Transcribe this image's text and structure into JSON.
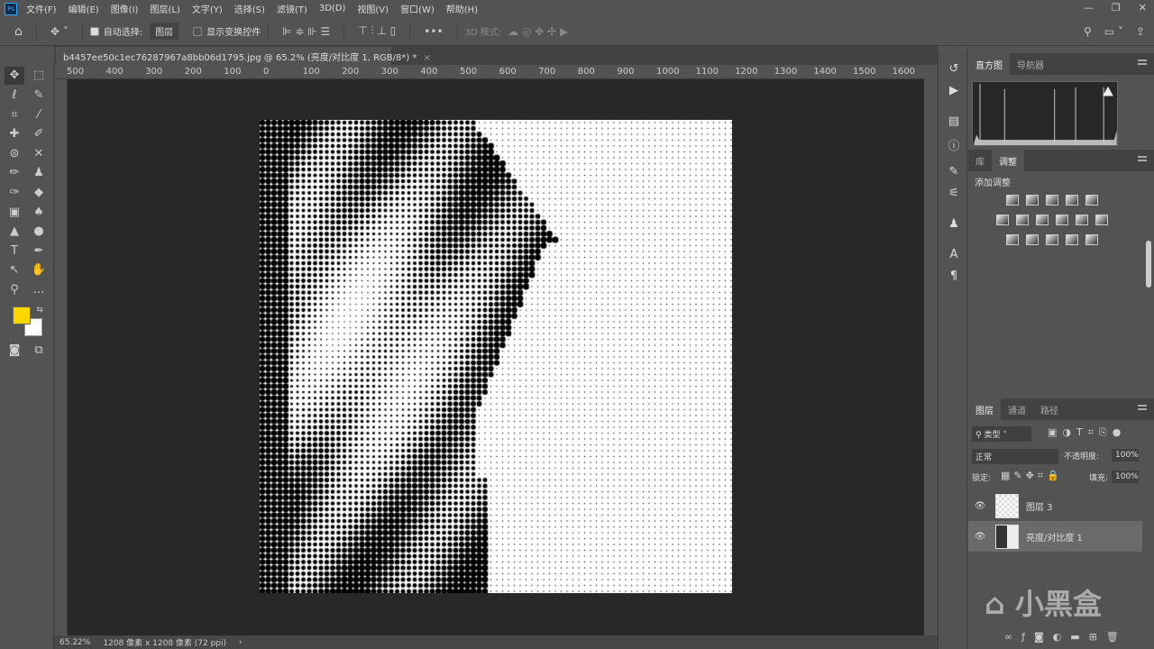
{
  "app": {
    "logo": "Ps"
  },
  "menu": [
    "文件(F)",
    "编辑(E)",
    "图像(I)",
    "图层(L)",
    "文字(Y)",
    "选择(S)",
    "滤镜(T)",
    "3D(D)",
    "视图(V)",
    "窗口(W)",
    "帮助(H)"
  ],
  "window_buttons": [
    "—",
    "❐",
    "✕"
  ],
  "options": {
    "auto_select_label": "自动选择:",
    "auto_select_value": "图层",
    "show_transform_label": "显示变换控件",
    "mode_3d_label": "3D 模式:",
    "more": "•••"
  },
  "document": {
    "tab_title": "b4457ee50c1ec76287967a8bb06d1795.jpg @ 65.2% (亮度/对比度 1, RGB/8*) *",
    "close": "×"
  },
  "ruler_top": [
    "500",
    "400",
    "300",
    "200",
    "100",
    "0",
    "100",
    "200",
    "300",
    "400",
    "500",
    "600",
    "700",
    "800",
    "900",
    "1000",
    "1100",
    "1200",
    "1300",
    "1400",
    "1500",
    "1600"
  ],
  "status": {
    "zoom": "65.22%",
    "info": "1208 像素 x 1208 像素 (72 ppi)",
    "arrow": "›"
  },
  "colors": {
    "foreground": "#ffd800",
    "background": "#ffffff"
  },
  "panels": {
    "top_tabs": [
      "直方图",
      "导航器"
    ],
    "mid_tabs": [
      "库",
      "调整"
    ],
    "add_adjustment": "添加调整",
    "layer_tabs": [
      "图层",
      "通道",
      "路径"
    ],
    "filter_kind": "类型",
    "blend_mode": "正常",
    "opacity_label": "不透明度:",
    "opacity": "100%",
    "lock_label": "锁定:",
    "fill_label": "填充:",
    "fill": "100%",
    "layers": [
      {
        "name": "图层 3",
        "selected": false
      },
      {
        "name": "亮度/对比度 1",
        "selected": true
      }
    ],
    "footer_icons": [
      "link",
      "fx",
      "mask",
      "adjustment",
      "folder",
      "new",
      "trash"
    ]
  },
  "watermark": "小黑盒"
}
